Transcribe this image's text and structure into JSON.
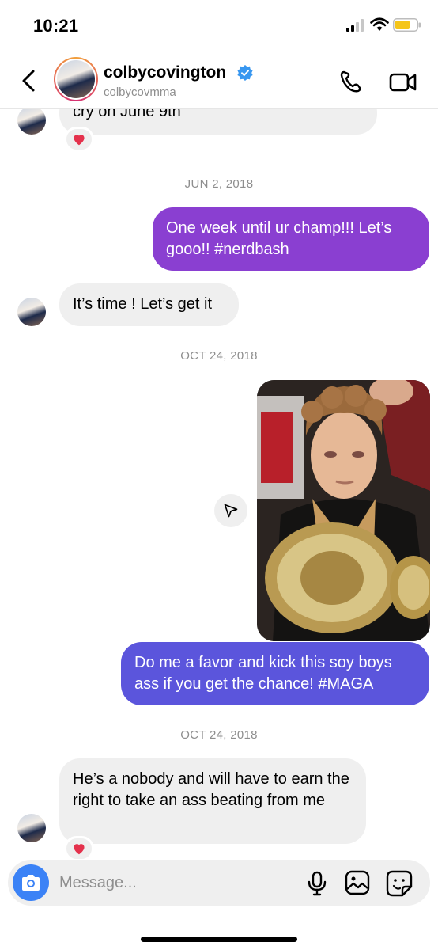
{
  "status_bar": {
    "time": "10:21"
  },
  "header": {
    "name": "colbycovington",
    "handle": "colbycovmma",
    "verified": true,
    "icons": [
      "back-icon",
      "phone-icon",
      "video-icon",
      "verified-icon"
    ]
  },
  "colors": {
    "bubble_purple": "#8a3fd1",
    "bubble_blue": "#5b55dc",
    "incoming_bubble": "#efefef",
    "reaction_heart": "#e4314c",
    "camera_button": "#3b82f6"
  },
  "messages": {
    "m0": {
      "text": "cry on June 9th",
      "reaction": "heart"
    },
    "date1": "JUN 2, 2018",
    "m1": {
      "text": "One week until ur champ!!! Let’s gooo!!  #nerdbash"
    },
    "m2": {
      "text": "It’s time ! Let’s get it"
    },
    "date2": "OCT 24, 2018",
    "m3": {
      "type": "photo"
    },
    "m4": {
      "text": "Do me a favor and kick this soy boys ass if you get the chance! #MAGA"
    },
    "date3": "OCT 24, 2018",
    "m5": {
      "text": "He’s a nobody and will have to earn the right to take an ass beating from me",
      "reaction": "heart"
    }
  },
  "composer": {
    "placeholder": "Message..."
  }
}
